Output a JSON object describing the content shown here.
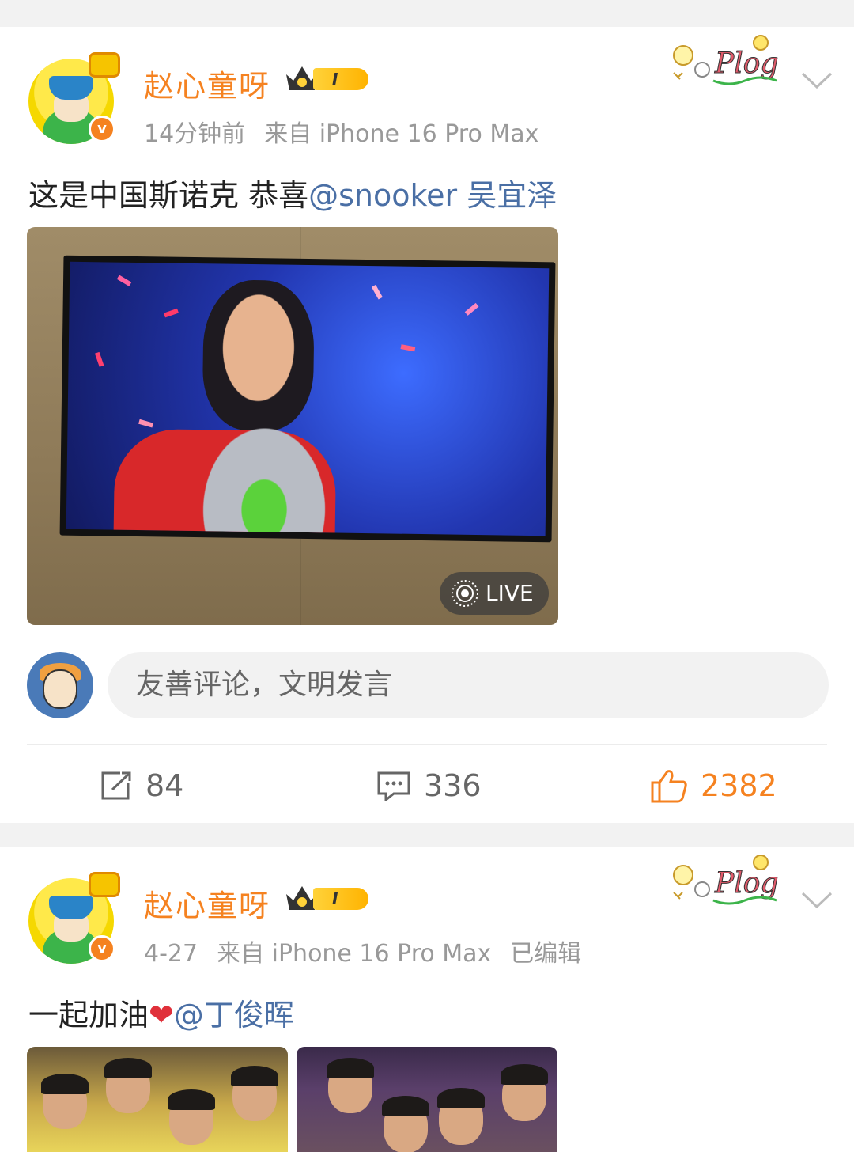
{
  "posts": [
    {
      "username": "赵心童呀",
      "level": "I",
      "time": "14分钟前",
      "source": "来自 iPhone 16 Pro Max",
      "edited": "",
      "text_plain": "这是中国斯诺克 恭喜",
      "mention": "@snooker 吴宜泽",
      "live_label": "LIVE",
      "comment_placeholder": "友善评论，文明发言",
      "reposts": "84",
      "comments": "336",
      "likes": "2382"
    },
    {
      "username": "赵心童呀",
      "level": "I",
      "time": "4-27",
      "source": "来自 iPhone 16 Pro Max",
      "edited": "已编辑",
      "text_plain": "一起加油",
      "heart": "❤",
      "mention": "@丁俊晖"
    }
  ],
  "badge_text": "Plog",
  "colors": {
    "username": "#f58220",
    "mention": "#4a6fa5",
    "like_active": "#f58220",
    "meta": "#999999",
    "verified": "#f58220"
  },
  "icons": [
    "crown-level-icon",
    "plog-sticker-icon",
    "chevron-down-icon",
    "live-photo-icon",
    "repost-icon",
    "comment-icon",
    "like-icon",
    "verified-icon"
  ]
}
